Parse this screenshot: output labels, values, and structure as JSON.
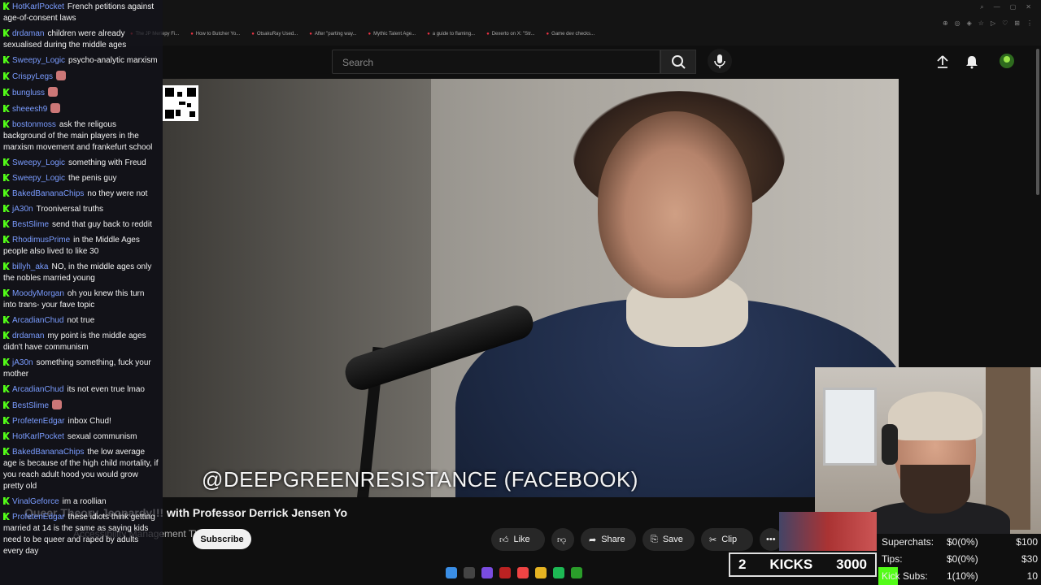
{
  "browser": {
    "bookmarks": [
      "The JP Meriepy Fi...",
      "How to Butcher Yo...",
      "OtsakuRay Used...",
      "After \"parting way...",
      "Mythic Talent Age...",
      "a guide to flaming...",
      "Dexerto on X: \"Str...",
      "Game dev checks..."
    ]
  },
  "youtube": {
    "search_placeholder": "Search",
    "video_caption": "@DEEPGREENRESISTANCE (FACEBOOK)",
    "title": "Queer Theory Jeopardy!!! with Professor Derrick Jensen Yo",
    "channel": "Accessibility Management TV",
    "subscribe_label": "Subscribe",
    "actions": {
      "like": "Like",
      "share": "Share",
      "save": "Save",
      "clip": "Clip"
    }
  },
  "chat": [
    {
      "user": "HotKarlPocket",
      "text": "French petitions against age-of-consent laws"
    },
    {
      "user": "drdaman",
      "text": "children were already sexualised during the middle ages"
    },
    {
      "user": "Sweepy_Logic",
      "text": "psycho-analytic marxism"
    },
    {
      "user": "CrispyLegs",
      "text": "",
      "emote": true
    },
    {
      "user": "bungluss",
      "text": "",
      "emote": true
    },
    {
      "user": "sheeesh9",
      "text": "",
      "emote": true
    },
    {
      "user": "bostonmoss",
      "text": "ask the religous background of the main players in the marxism movement and frankefurt school"
    },
    {
      "user": "Sweepy_Logic",
      "text": "something with Freud"
    },
    {
      "user": "Sweepy_Logic",
      "text": "the penis guy"
    },
    {
      "user": "BakedBananaChips",
      "text": "no they were not"
    },
    {
      "user": "jA30n",
      "text": "Trooniversal truths"
    },
    {
      "user": "BestSlime",
      "text": "send that guy back to reddit"
    },
    {
      "user": "RhodimusPrime",
      "text": "in the Middle Ages people also lived to like 30"
    },
    {
      "user": "billyh_aka",
      "text": "NO, in the middle ages only the nobles married young"
    },
    {
      "user": "MoodyMorgan",
      "text": "oh you knew this turn into trans- your fave topic"
    },
    {
      "user": "ArcadianChud",
      "text": "not true"
    },
    {
      "user": "drdaman",
      "text": "my point is the middle ages didn't have communism"
    },
    {
      "user": "jA30n",
      "text": "something something, fuck your mother"
    },
    {
      "user": "ArcadianChud",
      "text": "its not even true lmao"
    },
    {
      "user": "BestSlime",
      "text": "",
      "emote": true
    },
    {
      "user": "ProfetenEdgar",
      "text": "inbox Chud!"
    },
    {
      "user": "HotKarlPocket",
      "text": "sexual communism"
    },
    {
      "user": "BakedBananaChips",
      "text": "the low average age is because of the high child mortality, if you reach adult hood you would grow pretty old"
    },
    {
      "user": "VinalGeforce",
      "text": "im a roollian"
    },
    {
      "user": "ProfetenEdgar",
      "text": "these idiots think getting married at 14 is the same as saying kids need to be queer and raped by adults every day"
    }
  ],
  "stats": {
    "rows": [
      {
        "label": "Superchats:",
        "mid": "$0(0%)",
        "right": "$100"
      },
      {
        "label": "Tips:",
        "mid": "$0(0%)",
        "right": "$30"
      },
      {
        "label": "Kick Subs:",
        "mid": "1(10%)",
        "right": "10"
      }
    ],
    "kicks_count": "2",
    "kicks_label": "KICKS",
    "kicks_goal": "3000"
  }
}
